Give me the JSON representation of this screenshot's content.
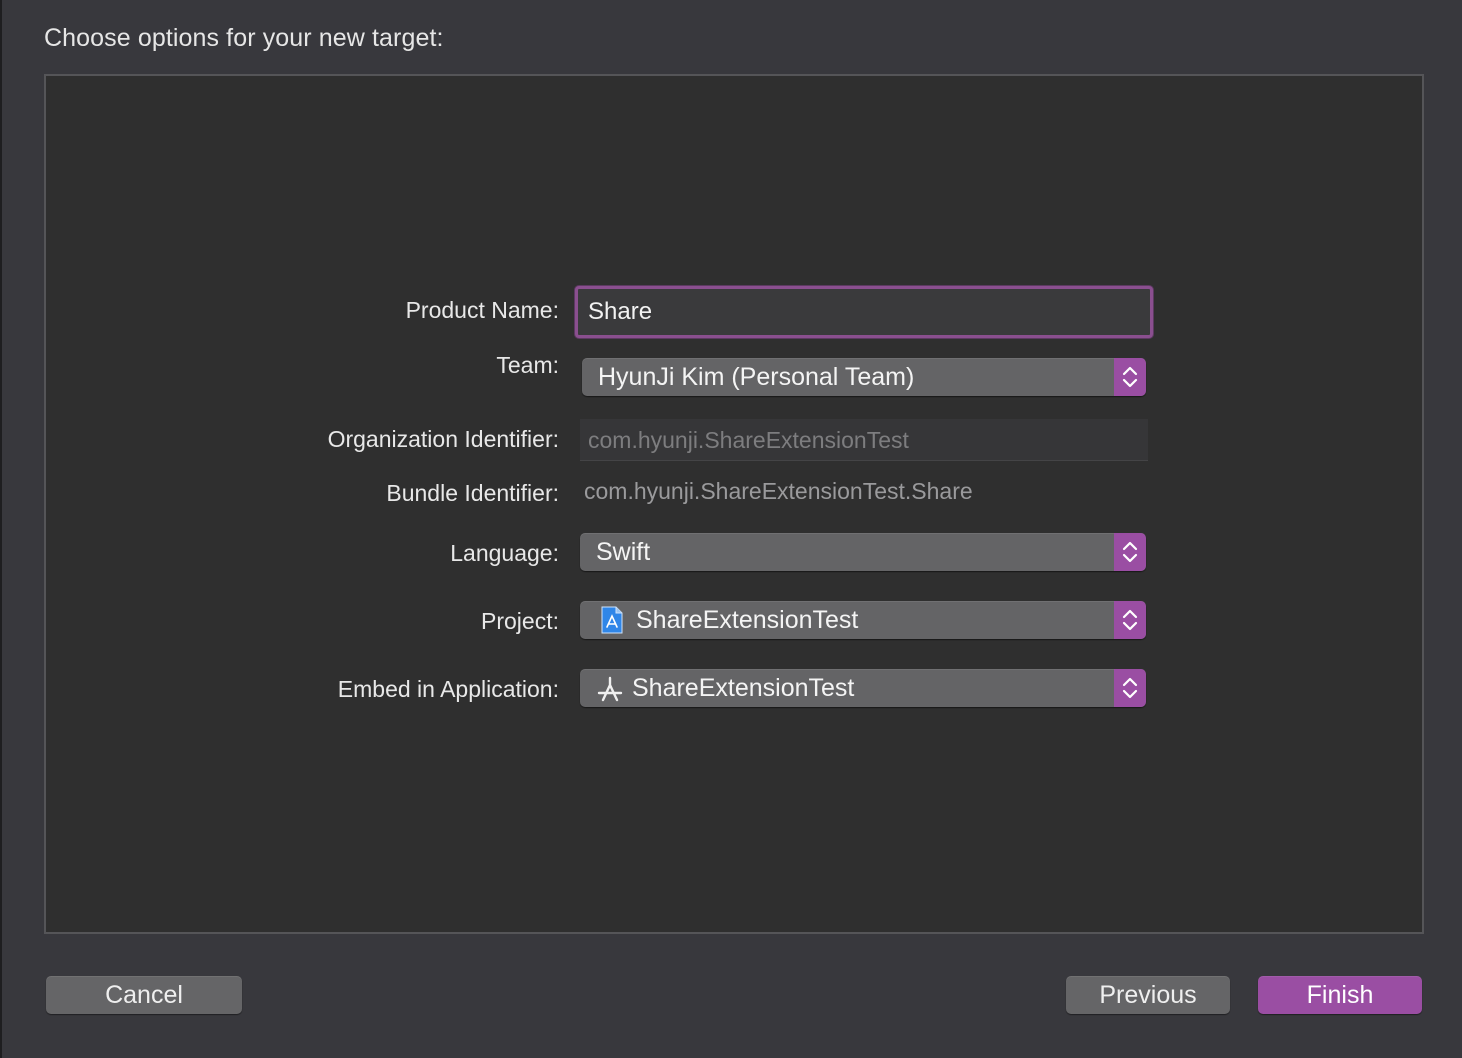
{
  "dialog": {
    "title": "Choose options for your new target:"
  },
  "form": {
    "product_name": {
      "label": "Product Name:",
      "value": "Share"
    },
    "team": {
      "label": "Team:",
      "value": "HyunJi Kim (Personal Team)"
    },
    "organization_identifier": {
      "label": "Organization Identifier:",
      "value": "com.hyunji.ShareExtensionTest"
    },
    "bundle_identifier": {
      "label": "Bundle Identifier:",
      "value": "com.hyunji.ShareExtensionTest.Share"
    },
    "language": {
      "label": "Language:",
      "value": "Swift"
    },
    "project": {
      "label": "Project:",
      "value": "ShareExtensionTest",
      "icon": "xcode-project-icon"
    },
    "embed_in_application": {
      "label": "Embed in Application:",
      "value": "ShareExtensionTest",
      "icon": "app-target-icon"
    }
  },
  "buttons": {
    "cancel": "Cancel",
    "previous": "Previous",
    "finish": "Finish"
  },
  "colors": {
    "accent": "#9a4ea3",
    "focus_ring": "#8a4f8f",
    "background": "#38383d",
    "panel": "#2f2f2f"
  }
}
